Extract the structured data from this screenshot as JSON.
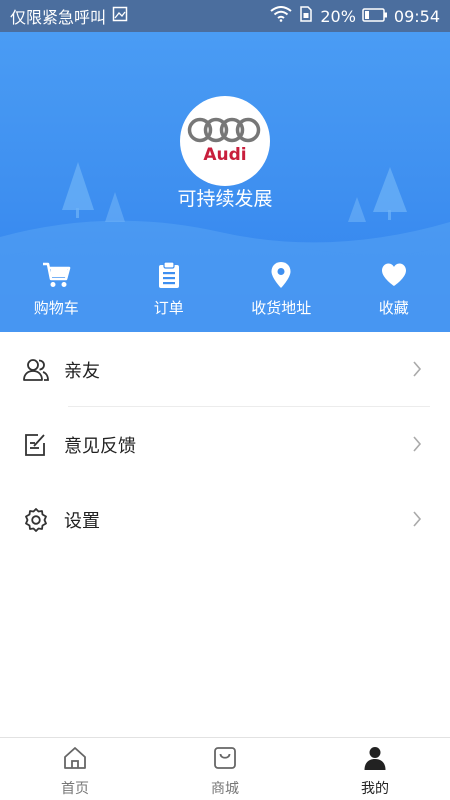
{
  "status_bar": {
    "carrier": "仅限紧急呼叫",
    "battery": "20%",
    "time": "09:54"
  },
  "profile": {
    "logo_text": "Audi",
    "name": "可持续发展"
  },
  "quick_actions": [
    {
      "label": "购物车",
      "icon": "cart-icon"
    },
    {
      "label": "订单",
      "icon": "order-clipboard-icon"
    },
    {
      "label": "收货地址",
      "icon": "location-pin-icon"
    },
    {
      "label": "收藏",
      "icon": "heart-icon"
    }
  ],
  "menu": [
    {
      "label": "亲友",
      "icon": "friends-icon"
    },
    {
      "label": "意见反馈",
      "icon": "feedback-edit-icon"
    },
    {
      "label": "设置",
      "icon": "gear-icon"
    }
  ],
  "tabbar": [
    {
      "label": "首页",
      "icon": "home-icon",
      "active": false
    },
    {
      "label": "商城",
      "icon": "shopping-bag-icon",
      "active": false
    },
    {
      "label": "我的",
      "icon": "person-icon",
      "active": true
    }
  ],
  "colors": {
    "hero_blue": "#3e8ff0",
    "brand_red": "#c81e3c",
    "status_bar": "#4b6e9e"
  }
}
